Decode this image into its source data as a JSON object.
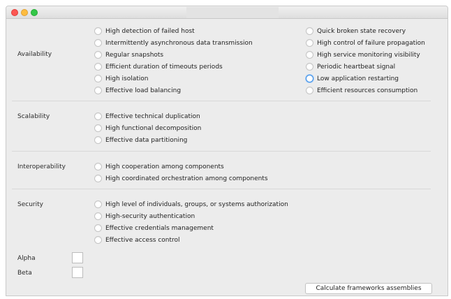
{
  "groups": {
    "availability": {
      "label": "Availability",
      "left_options": [
        "High detection of failed host",
        "Intermittently asynchronous data transmission",
        "Regular snapshots",
        "Efficient duration of timeouts periods",
        "High isolation",
        "Effective load balancing"
      ],
      "right_options": [
        "Quick broken state recovery",
        "High control of failure propagation",
        "High service monitoring visibility",
        "Periodic heartbeat signal",
        "Low application restarting",
        "Efficient resources consumption"
      ]
    },
    "scalability": {
      "label": "Scalability",
      "options": [
        "Effective technical duplication",
        "High functional decomposition",
        "Effective data partitioning"
      ]
    },
    "interoperability": {
      "label": "Interoperability",
      "options": [
        "High cooperation among components",
        "High coordinated orchestration among components"
      ]
    },
    "security": {
      "label": "Security",
      "options": [
        "High level of individuals, groups, or systems authorization",
        "High-security authentication",
        "Effective credentials management",
        "Effective access control"
      ]
    }
  },
  "params": {
    "alpha_label": "Alpha",
    "beta_label": "Beta",
    "alpha_value": "",
    "beta_value": ""
  },
  "actions": {
    "calculate_label": "Calculate frameworks assemblies"
  },
  "colors": {
    "close": "#fc5753",
    "minimize": "#fdbc40",
    "maximize": "#33c748",
    "focus_ring": "#3a8fe8"
  }
}
